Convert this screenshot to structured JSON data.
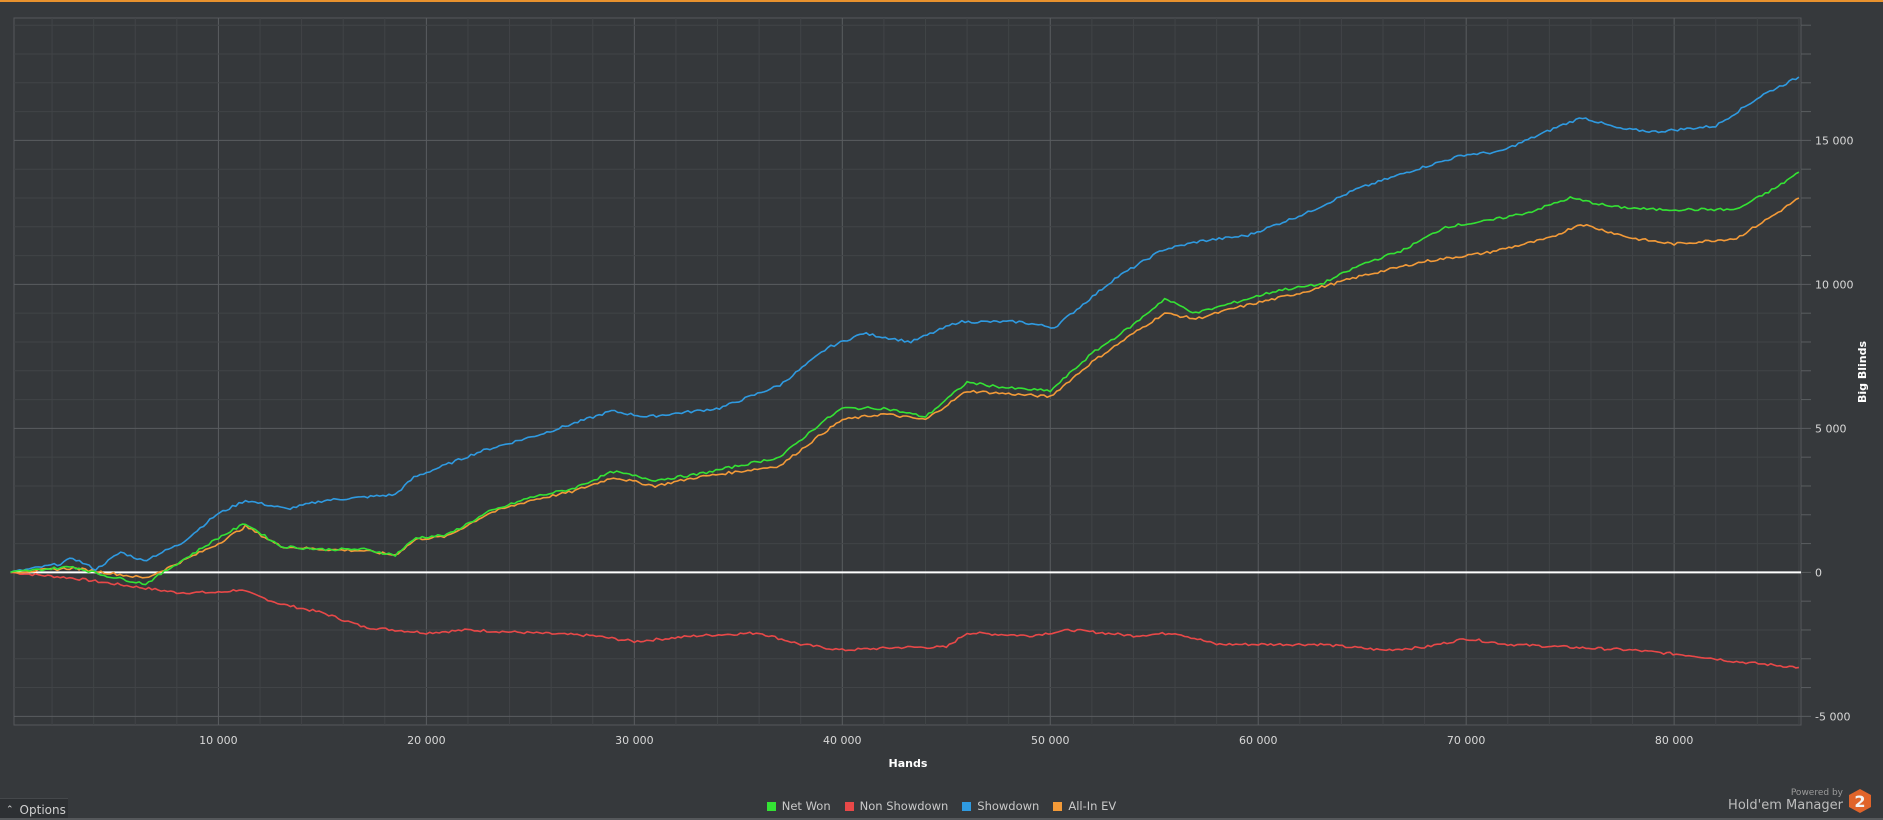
{
  "chart_data": {
    "type": "line",
    "title": "",
    "xlabel": "Hands",
    "ylabel": "Big Blinds",
    "xlim": [
      170,
      86100
    ],
    "ylim": [
      -5300,
      19250
    ],
    "x_ticks": [
      10000,
      20000,
      30000,
      40000,
      50000,
      60000,
      70000,
      80000
    ],
    "x_tick_labels": [
      "10 000",
      "20 000",
      "30 000",
      "40 000",
      "50 000",
      "60 000",
      "70 000",
      "80 000"
    ],
    "y_ticks": [
      -5000,
      0,
      5000,
      10000,
      15000
    ],
    "y_tick_labels": [
      "-5 000",
      "0",
      "5 000",
      "10 000",
      "15 000"
    ],
    "grid": true,
    "legend_position": "bottom-center",
    "series": [
      {
        "name": "Net Won",
        "color": "#34e234",
        "x": [
          0,
          3000,
          4500,
          6500,
          8000,
          10000,
          11300,
          13000,
          15000,
          17000,
          18500,
          19500,
          21000,
          23000,
          25000,
          27000,
          29000,
          31000,
          33000,
          35000,
          37000,
          39000,
          40000,
          42000,
          44000,
          46000,
          48000,
          50000,
          52000,
          54000,
          55500,
          57000,
          59000,
          61000,
          63000,
          65000,
          67000,
          69000,
          71000,
          73000,
          75000,
          77000,
          79000,
          81000,
          83000,
          85000,
          86000
        ],
        "y": [
          0,
          200,
          -100,
          -400,
          300,
          1200,
          1700,
          900,
          800,
          800,
          600,
          1200,
          1300,
          2100,
          2600,
          2900,
          3500,
          3200,
          3400,
          3700,
          4000,
          5200,
          5700,
          5700,
          5400,
          6600,
          6400,
          6300,
          7600,
          8600,
          9500,
          9000,
          9400,
          9800,
          10000,
          10700,
          11200,
          12000,
          12200,
          12500,
          13000,
          12700,
          12600,
          12600,
          12600,
          13400,
          13900
        ]
      },
      {
        "name": "Non Showdown",
        "color": "#e84848",
        "x": [
          0,
          3000,
          5000,
          8000,
          10000,
          11000,
          13000,
          15000,
          17000,
          20000,
          22000,
          25000,
          28000,
          30000,
          33000,
          36000,
          38000,
          40000,
          43000,
          45000,
          46000,
          49000,
          51000,
          54000,
          56000,
          58000,
          60000,
          63000,
          66000,
          68000,
          70000,
          72000,
          75000,
          78000,
          81000,
          83000,
          86000
        ],
        "y": [
          0,
          -200,
          -400,
          -700,
          -700,
          -600,
          -1100,
          -1400,
          -1900,
          -2100,
          -2000,
          -2100,
          -2200,
          -2400,
          -2200,
          -2100,
          -2500,
          -2700,
          -2600,
          -2600,
          -2100,
          -2200,
          -2000,
          -2200,
          -2100,
          -2500,
          -2500,
          -2500,
          -2700,
          -2600,
          -2300,
          -2500,
          -2600,
          -2700,
          -2900,
          -3100,
          -3300
        ]
      },
      {
        "name": "Showdown",
        "color": "#2f9ae0",
        "x": [
          0,
          2400,
          3000,
          4100,
          5300,
          6400,
          8200,
          9900,
          11300,
          13300,
          15100,
          18500,
          19400,
          22600,
          25500,
          28900,
          30600,
          34100,
          37000,
          39300,
          41000,
          43300,
          45600,
          48500,
          50200,
          53100,
          55400,
          57200,
          59500,
          62400,
          64700,
          67600,
          69900,
          71600,
          74500,
          75600,
          77400,
          79100,
          82000,
          84300,
          86000
        ],
        "y": [
          0,
          300,
          500,
          100,
          700,
          400,
          1000,
          2000,
          2500,
          2200,
          2500,
          2700,
          3300,
          4200,
          4800,
          5600,
          5400,
          5700,
          6500,
          7800,
          8300,
          8000,
          8700,
          8700,
          8500,
          10200,
          11200,
          11500,
          11700,
          12500,
          13300,
          14000,
          14500,
          14600,
          15500,
          15800,
          15400,
          15300,
          15500,
          16600,
          17200
        ]
      },
      {
        "name": "All-In EV",
        "color": "#f39a38",
        "x": [
          0,
          3000,
          4500,
          6500,
          8000,
          10000,
          11300,
          13000,
          15000,
          17000,
          18500,
          19500,
          21000,
          23000,
          25000,
          27000,
          29000,
          31000,
          33000,
          35000,
          37000,
          39000,
          40000,
          42000,
          44000,
          46000,
          48000,
          50000,
          52000,
          54000,
          55500,
          57000,
          59000,
          62000,
          65000,
          68000,
          71000,
          74000,
          75500,
          78000,
          80000,
          83000,
          85000,
          86000
        ],
        "y": [
          0,
          150,
          0,
          -200,
          300,
          1000,
          1600,
          900,
          800,
          750,
          600,
          1150,
          1250,
          2050,
          2500,
          2800,
          3300,
          3000,
          3300,
          3500,
          3700,
          4800,
          5300,
          5500,
          5300,
          6300,
          6200,
          6100,
          7300,
          8300,
          9000,
          8800,
          9200,
          9700,
          10300,
          10800,
          11100,
          11600,
          12100,
          11600,
          11400,
          11600,
          12500,
          13000
        ]
      }
    ]
  },
  "ui": {
    "options_label": "Options",
    "powered_by": "Powered by",
    "brand": "Hold'em Manager",
    "brand_logo_text": "2",
    "accent_color": "#e8922e"
  }
}
